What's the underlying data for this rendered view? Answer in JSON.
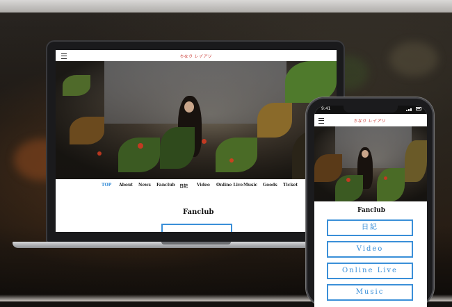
{
  "laptop": {
    "logo_text": "ちなり レイアリ",
    "nav": [
      "TOP",
      "About",
      "News",
      "Fanclub",
      "日記",
      "Video",
      "Online Live",
      "Music",
      "Goods",
      "Ticket"
    ],
    "active_nav": "TOP",
    "section_title": "Fanclub"
  },
  "phone": {
    "status_time": "9:41",
    "logo_text": "ちなり レイアリ",
    "section_title": "Fanclub",
    "buttons": [
      "日記",
      "Video",
      "Online Live",
      "Music"
    ]
  },
  "colors": {
    "accent": "#3a8fd8",
    "logo": "#c8322c"
  }
}
